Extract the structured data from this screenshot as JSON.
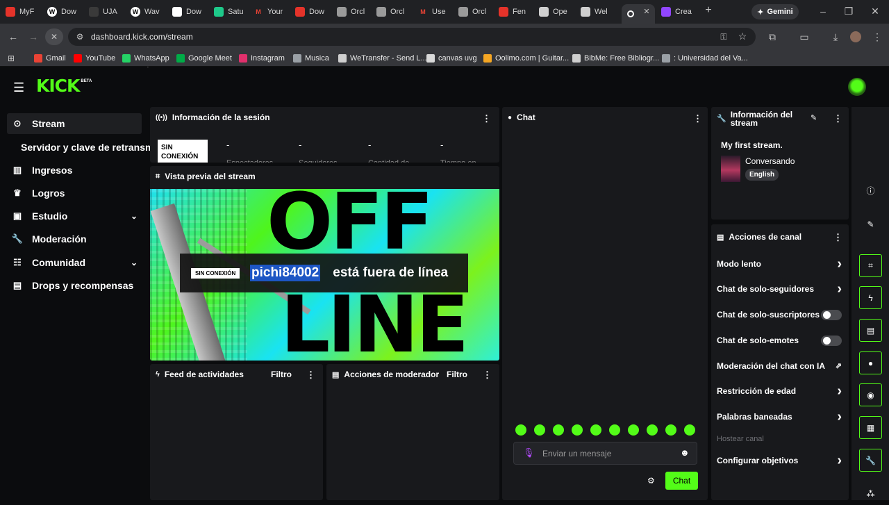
{
  "browser": {
    "tabs": [
      {
        "label": "MyF",
        "icon": "brand-red-icon",
        "color": "#e5332a"
      },
      {
        "label": "Dow",
        "icon": "wordpress-icon",
        "color": "#ffffff"
      },
      {
        "label": "UJA",
        "icon": "generic-tab-icon",
        "color": "#3a3a3a"
      },
      {
        "label": "Wav",
        "icon": "wordpress-icon",
        "color": "#ffffff"
      },
      {
        "label": "Dow",
        "icon": "download-site-icon",
        "color": "#ffffff"
      },
      {
        "label": "Satu",
        "icon": "green-site-icon",
        "color": "#1ec98a"
      },
      {
        "label": "Your",
        "icon": "gmail-icon",
        "color": "#ea4335"
      },
      {
        "label": "Dow",
        "icon": "red-a-icon",
        "color": "#e5332a"
      },
      {
        "label": "Orcl",
        "icon": "orchestra-icon",
        "color": "#9a9a9a"
      },
      {
        "label": "Orcl",
        "icon": "orchestra-icon",
        "color": "#9a9a9a"
      },
      {
        "label": "Use",
        "icon": "gmail-icon",
        "color": "#ea4335"
      },
      {
        "label": "Orcl",
        "icon": "orchestra-icon",
        "color": "#9a9a9a"
      },
      {
        "label": "Fen",
        "icon": "brand-red-icon",
        "color": "#e5332a"
      },
      {
        "label": "Ope",
        "icon": "openai-icon",
        "color": "#cfcfcf"
      },
      {
        "label": "Wel",
        "icon": "globe-icon",
        "color": "#cfcfcf"
      },
      {
        "label": "",
        "icon": "loading-icon",
        "color": "#ffffff"
      },
      {
        "label": "Crea",
        "icon": "twitch-icon",
        "color": "#9146ff"
      }
    ],
    "close_tab": "✕",
    "new_tab": "+",
    "gemini_label": "Gemini",
    "url": "dashboard.kick.com/stream",
    "bookmarks": [
      {
        "label": "Gmail",
        "icon": "gmail-icon",
        "color": "#ea4335"
      },
      {
        "label": "YouTube",
        "icon": "youtube-icon",
        "color": "#ff0000"
      },
      {
        "label": "WhatsApp",
        "icon": "whatsapp-icon",
        "color": "#25d366"
      },
      {
        "label": "Google Meet",
        "icon": "google-meet-icon",
        "color": "#00ac47"
      },
      {
        "label": "Instagram",
        "icon": "instagram-icon",
        "color": "#e1306c"
      },
      {
        "label": "Musica",
        "icon": "folder-icon",
        "color": "#9aa0a6"
      },
      {
        "label": "WeTransfer - Send L...",
        "icon": "wetransfer-icon",
        "color": "#cfcfcf"
      },
      {
        "label": "canvas uvg",
        "icon": "canvas-icon",
        "color": "#d9d9d9"
      },
      {
        "label": "Oolimo.com | Guitar...",
        "icon": "oolimo-icon",
        "color": "#f5a623"
      },
      {
        "label": "BibMe: Free Bibliogr...",
        "icon": "bibme-icon",
        "color": "#cfcfcf"
      },
      {
        "label": ": Universidad del Va...",
        "icon": "globe-icon",
        "color": "#9aa0a6"
      }
    ]
  },
  "kick": {
    "logo": "KICK",
    "logo_badge": "BETA",
    "accent": "#53fc18",
    "sidebar": [
      {
        "label": "Stream",
        "icon": "stream-icon",
        "active": true
      },
      {
        "label": "Servidor y clave de retransm",
        "icon": "",
        "sub": true
      },
      {
        "label": "Ingresos",
        "icon": "revenue-icon"
      },
      {
        "label": "Logros",
        "icon": "trophy-icon"
      },
      {
        "label": "Estudio",
        "icon": "studio-icon",
        "expand": true
      },
      {
        "label": "Moderación",
        "icon": "wrench-icon"
      },
      {
        "label": "Comunidad",
        "icon": "community-icon",
        "expand": true
      },
      {
        "label": "Drops y recompensas",
        "icon": "gift-icon"
      }
    ],
    "session": {
      "title": "Información de la sesión",
      "status": "SIN CONEXIÓN",
      "stats": [
        {
          "value": "-",
          "label": "Espectadores"
        },
        {
          "value": "-",
          "label": "Seguidores"
        },
        {
          "value": "-",
          "label": "Cantidad de"
        },
        {
          "value": "-",
          "label": "Tiempo en"
        }
      ]
    },
    "preview": {
      "title": "Vista previa del stream",
      "badge": "SIN CONEXIÓN",
      "username": "pichi84002",
      "offline_text": " está fuera de línea",
      "bg_word_1": "OFF",
      "bg_word_2": "LINE"
    },
    "feed": {
      "title": "Feed de actividades",
      "filter": "Filtro"
    },
    "modactions": {
      "title": "Acciones de moderador",
      "filter": "Filtro"
    },
    "chat": {
      "title": "Chat",
      "placeholder": "Enviar un mensaje",
      "send_label": "Chat"
    },
    "stream_info": {
      "title": "Información del stream",
      "stream_title": "My first stream.",
      "category": "Conversando",
      "language": "English"
    },
    "channel_actions": {
      "title": "Acciones de canal",
      "items": [
        {
          "label": "Modo lento",
          "control": "chevron"
        },
        {
          "label": "Chat de solo-seguidores",
          "control": "chevron"
        },
        {
          "label": "Chat de solo-suscriptores",
          "control": "toggle"
        },
        {
          "label": "Chat de solo-emotes",
          "control": "toggle"
        },
        {
          "label": "Moderación del chat con IA",
          "control": "external"
        },
        {
          "label": "Restricción de edad",
          "control": "chevron"
        },
        {
          "label": "Palabras baneadas",
          "control": "chevron"
        },
        {
          "label": "Hostear canal",
          "control": "disabled"
        },
        {
          "label": "Configurar objetivos",
          "control": "chevron"
        }
      ]
    },
    "right_rail": [
      "info-icon",
      "edit-icon",
      "preview-icon",
      "bolt-icon",
      "note-icon",
      "chat-bubble-icon",
      "broadcast-icon",
      "mod-actions-icon",
      "wrench-icon",
      "share-icon"
    ]
  }
}
